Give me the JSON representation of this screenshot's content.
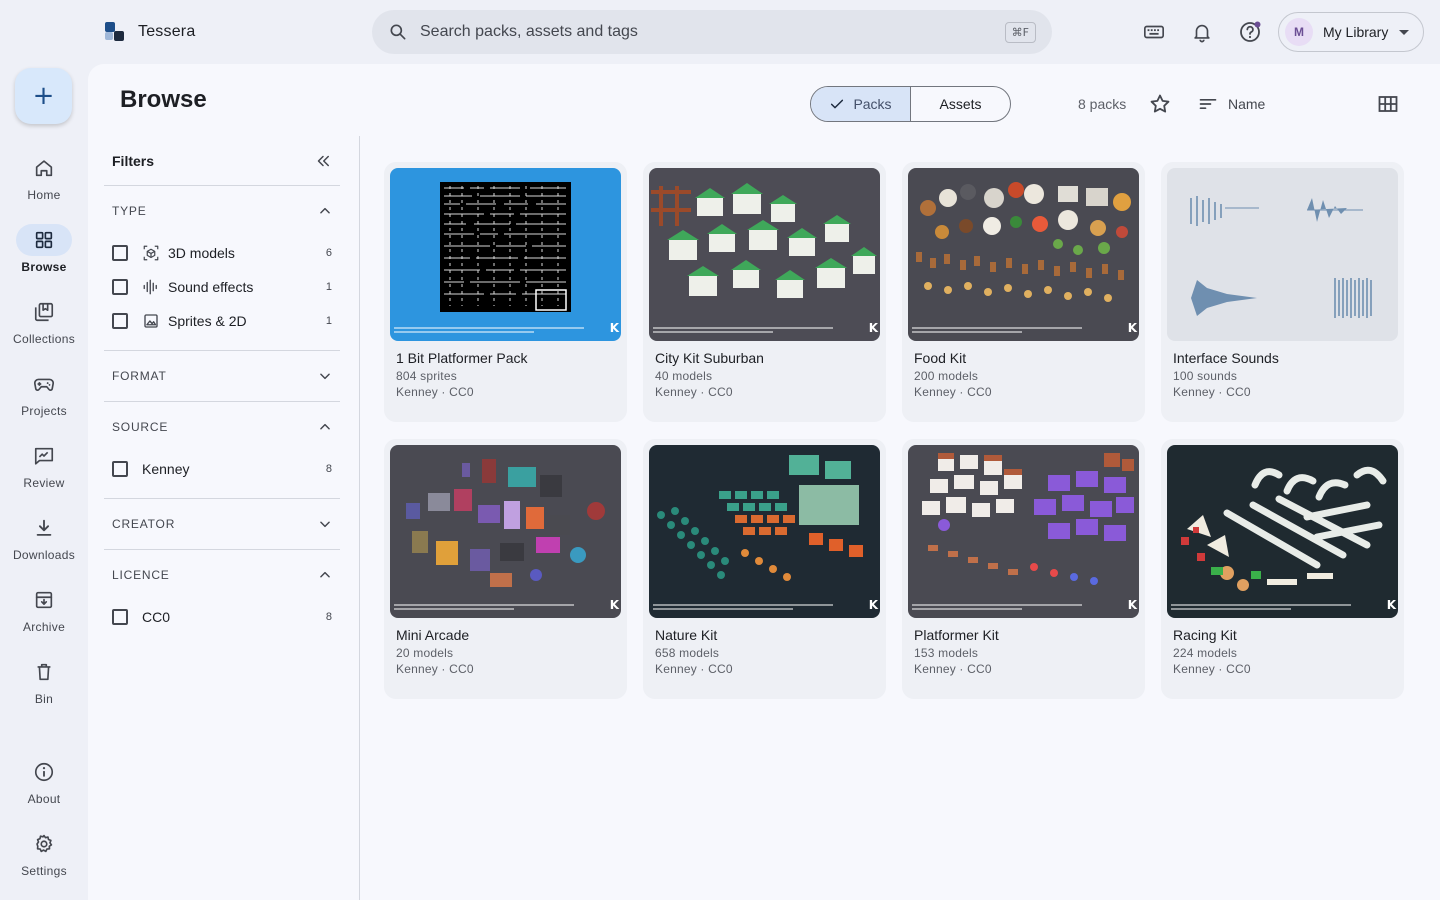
{
  "app": {
    "name": "Tessera"
  },
  "search": {
    "placeholder": "Search packs, assets and tags",
    "shortcut": "⌘F"
  },
  "profile": {
    "initial": "M",
    "label": "My Library"
  },
  "nav": {
    "new_label": "+",
    "items": [
      {
        "label": "Home",
        "icon": "home-icon"
      },
      {
        "label": "Browse",
        "icon": "grid-icon",
        "active": true
      },
      {
        "label": "Collections",
        "icon": "collections-icon"
      },
      {
        "label": "Projects",
        "icon": "gamepad-icon"
      },
      {
        "label": "Review",
        "icon": "review-icon"
      },
      {
        "label": "Downloads",
        "icon": "download-icon"
      },
      {
        "label": "Archive",
        "icon": "archive-icon"
      },
      {
        "label": "Bin",
        "icon": "trash-icon"
      },
      {
        "label": "About",
        "icon": "info-icon"
      },
      {
        "label": "Settings",
        "icon": "gear-icon"
      }
    ]
  },
  "page": {
    "title": "Browse"
  },
  "toolbar": {
    "packs_label": "Packs",
    "assets_label": "Assets",
    "count_label": "8 packs",
    "sort_label": "Name"
  },
  "filters": {
    "title": "Filters",
    "sections": {
      "type": {
        "title": "TYPE",
        "options": [
          {
            "label": "3D models",
            "count": "6",
            "icon": "cube-icon"
          },
          {
            "label": "Sound effects",
            "count": "1",
            "icon": "waveform-icon"
          },
          {
            "label": "Sprites & 2D",
            "count": "1",
            "icon": "image-icon"
          }
        ]
      },
      "format": {
        "title": "FORMAT"
      },
      "source": {
        "title": "SOURCE",
        "options": [
          {
            "label": "Kenney",
            "count": "8"
          }
        ]
      },
      "creator": {
        "title": "CREATOR"
      },
      "licence": {
        "title": "LICENCE",
        "options": [
          {
            "label": "CC0",
            "count": "8"
          }
        ]
      }
    }
  },
  "packs": [
    {
      "title": "1 Bit Platformer Pack",
      "count": "804 sprites",
      "meta": "Kenney · CC0",
      "bg": "#2d95df"
    },
    {
      "title": "City Kit Suburban",
      "count": "40 models",
      "meta": "Kenney · CC0",
      "bg": "#4d4c55"
    },
    {
      "title": "Food Kit",
      "count": "200 models",
      "meta": "Kenney · CC0",
      "bg": "#4a4a52"
    },
    {
      "title": "Interface Sounds",
      "count": "100 sounds",
      "meta": "Kenney · CC0",
      "bg": "#dfe2e8"
    },
    {
      "title": "Mini Arcade",
      "count": "20 models",
      "meta": "Kenney · CC0",
      "bg": "#4a4a52"
    },
    {
      "title": "Nature Kit",
      "count": "658 models",
      "meta": "Kenney · CC0",
      "bg": "#1f2a33"
    },
    {
      "title": "Platformer Kit",
      "count": "153 models",
      "meta": "Kenney · CC0",
      "bg": "#4a4a52"
    },
    {
      "title": "Racing Kit",
      "count": "224 models",
      "meta": "Kenney · CC0",
      "bg": "#1f2a30"
    }
  ],
  "colors": {
    "accent": "#1d4e89",
    "active_pill": "#d8e4f7",
    "surface": "#f7f8fd",
    "background": "#eef0f7"
  }
}
